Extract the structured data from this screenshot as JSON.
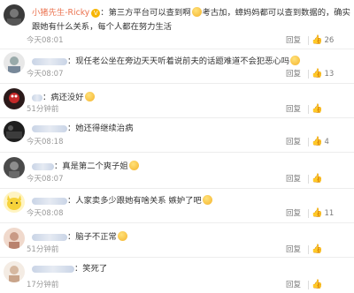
{
  "labels": {
    "reply": "回复"
  },
  "icons": {
    "like": "thumbs-up-icon",
    "verified": "vip-badge-icon",
    "emoji": "smiley-emoji-icon"
  },
  "colors": {
    "username": "#eb7350",
    "meta": "#9a9a9a"
  },
  "comments": [
    {
      "user": "小猪先生-Ricky",
      "text_a": "：第三方平台可以查到啊",
      "text_b": "考古加，蟑妈妈都可以查到数据的，确实是这么多，再一个",
      "text_c": "跟她有什么关系，每个人都在努力生活",
      "time": "今天08:01",
      "likes": "26"
    },
    {
      "user": "",
      "text_a": "：现任老公坐在旁边天天听着说前夫的话题难道不会犯恶心吗",
      "time": "今天08:07",
      "likes": "13"
    },
    {
      "user": "",
      "text_a": "：病还没好",
      "time": "51分钟前",
      "likes": ""
    },
    {
      "user": "",
      "text_a": "：她还得继续治病",
      "time": "今天08:18",
      "likes": "4"
    },
    {
      "user": "",
      "text_a": "：真是第二个爽子姐",
      "time": "今天08:07",
      "likes": ""
    },
    {
      "user": "",
      "text_a": "：人家卖多少跟她有啥关系 嫉妒了吧",
      "time": "今天08:08",
      "likes": "11"
    },
    {
      "user": "",
      "text_a": "：脑子不正常",
      "time": "51分钟前",
      "likes": ""
    },
    {
      "user": "",
      "text_a": "：笑死了",
      "time": "17分钟前",
      "likes": ""
    }
  ]
}
